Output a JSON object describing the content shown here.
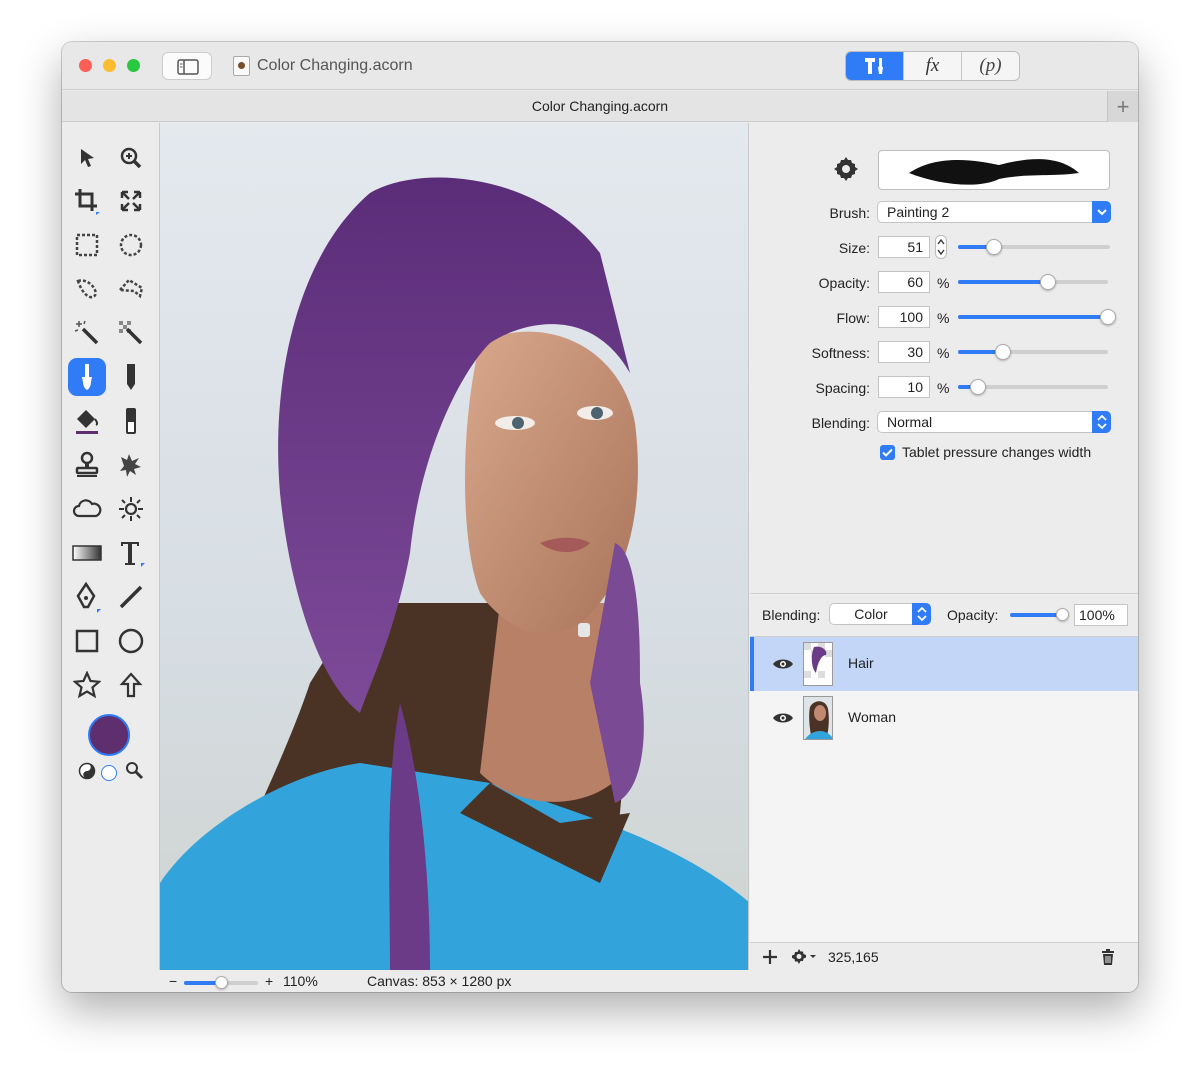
{
  "window": {
    "title": "Color Changing.acorn",
    "tab_title": "Color Changing.acorn",
    "traffic_lights": [
      "#fd5f57",
      "#febc2e",
      "#28c840"
    ],
    "accent": "#2f7cf6"
  },
  "toolbar_segments": [
    {
      "name": "tools-icon",
      "label": "",
      "active": true
    },
    {
      "name": "fx-icon",
      "label": "fx",
      "active": false
    },
    {
      "name": "p-icon",
      "label": "(p)",
      "active": false
    }
  ],
  "tools": [
    "move-arrow",
    "zoom",
    "crop",
    "transform",
    "rect-select",
    "ellipse-select",
    "lasso",
    "polygon-lasso",
    "magic-wand",
    "instant-alpha",
    "brush",
    "pencil",
    "paint-bucket",
    "eraser",
    "clone-stamp",
    "burn",
    "cloud",
    "sun",
    "gradient",
    "text",
    "pen",
    "line",
    "rectangle",
    "circle",
    "star",
    "arrow"
  ],
  "active_tool": "brush",
  "foreground_color": "#5e2e6f",
  "brush_panel": {
    "brush_label": "Brush:",
    "brush_value": "Painting 2",
    "size_label": "Size:",
    "size_value": "51",
    "size_fraction": 0.24,
    "opacity_label": "Opacity:",
    "opacity_value": "60",
    "opacity_fraction": 0.6,
    "flow_label": "Flow:",
    "flow_value": "100",
    "flow_fraction": 1.0,
    "softness_label": "Softness:",
    "softness_value": "30",
    "softness_fraction": 0.3,
    "spacing_label": "Spacing:",
    "spacing_value": "10",
    "spacing_fraction": 0.13,
    "percent": "%",
    "blending_label": "Blending:",
    "blending_value": "Normal",
    "tablet_checkbox_label": "Tablet pressure changes width",
    "tablet_checked": true
  },
  "layers_panel": {
    "blending_label": "Blending:",
    "blending_value": "Color",
    "opacity_label": "Opacity:",
    "opacity_value": "100%",
    "opacity_fraction": 1.0,
    "layers": [
      {
        "name": "Hair",
        "selected": true
      },
      {
        "name": "Woman",
        "selected": false
      }
    ],
    "coordinates": "325,165"
  },
  "status": {
    "zoom_minus": "−",
    "zoom_plus": "+",
    "zoom_value": "110%",
    "zoom_fraction": 0.5,
    "canvas_info": "Canvas: 853 × 1280 px"
  }
}
